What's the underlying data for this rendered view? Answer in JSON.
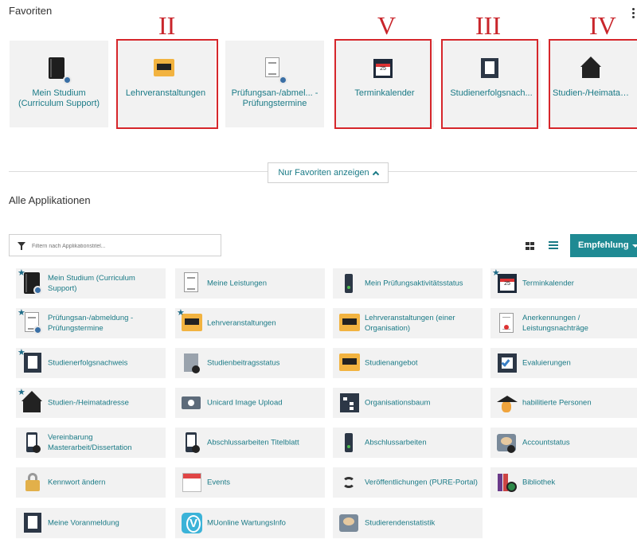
{
  "favorites": {
    "title": "Favoriten",
    "tiles": [
      {
        "label": "Mein Studium (Curriculum Support)",
        "icon": "book-gear-icon"
      },
      {
        "label": "Lehrveranstaltungen",
        "icon": "blackboard-icon"
      },
      {
        "label": "Prüfungsan-/abmel... - Prüfungstermine",
        "icon": "exam-sheet-icon"
      },
      {
        "label": "Terminkalender",
        "icon": "calendar-icon",
        "calendar_day": "25"
      },
      {
        "label": "Studienerfolgsnach...",
        "icon": "document-stack-icon"
      },
      {
        "label": "Studien-/Heimatadr...",
        "icon": "house-icon"
      }
    ],
    "annotations": [
      "II",
      "V",
      "III",
      "IV"
    ],
    "toggle_label": "Nur Favoriten anzeigen"
  },
  "all_apps": {
    "title": "Alle Applikationen",
    "filter_placeholder": "Filtern nach Applikationstitel...",
    "sort_label": "Empfehlung",
    "accent_color": "#1f8a93",
    "annotation_color": "#d6262b",
    "items": [
      {
        "label": "Mein Studium (Curriculum Support)",
        "icon": "book-gear-icon",
        "favorite": true
      },
      {
        "label": "Meine Leistungen",
        "icon": "exam-sheet-icon",
        "favorite": false
      },
      {
        "label": "Mein Prüfungsaktivitätsstatus",
        "icon": "traffic-light-icon",
        "favorite": false
      },
      {
        "label": "Terminkalender",
        "icon": "calendar-icon",
        "favorite": true
      },
      {
        "label": "Prüfungsan-/abmeldung - Prüfungstermine",
        "icon": "exam-sheet-icon",
        "favorite": true
      },
      {
        "label": "Lehrveranstaltungen",
        "icon": "blackboard-icon",
        "favorite": true
      },
      {
        "label": "Lehrveranstaltungen (einer Organisation)",
        "icon": "blackboard-icon",
        "favorite": false
      },
      {
        "label": "Anerkennungen / Leistungsnachträge",
        "icon": "certificate-icon",
        "favorite": false
      },
      {
        "label": "Studienerfolgsnachweis",
        "icon": "document-stack-icon",
        "favorite": true
      },
      {
        "label": "Studienbeitragsstatus",
        "icon": "fee-status-icon",
        "favorite": false
      },
      {
        "label": "Studienangebot",
        "icon": "book-icon",
        "favorite": false
      },
      {
        "label": "Evaluierungen",
        "icon": "checkbox-icon",
        "favorite": false
      },
      {
        "label": "Studien-/Heimatadresse",
        "icon": "house-icon",
        "favorite": true
      },
      {
        "label": "Unicard Image Upload",
        "icon": "camera-icon",
        "favorite": false
      },
      {
        "label": "Organisationsbaum",
        "icon": "org-tree-icon",
        "favorite": false
      },
      {
        "label": "habilitierte Personen",
        "icon": "graduate-icon",
        "favorite": false
      },
      {
        "label": "Vereinbarung Masterarbeit/Dissertation",
        "icon": "agreement-icon",
        "favorite": false
      },
      {
        "label": "Abschlussarbeiten Titelblatt",
        "icon": "title-page-icon",
        "favorite": false
      },
      {
        "label": "Abschlussarbeiten",
        "icon": "thesis-icon",
        "favorite": false
      },
      {
        "label": "Accountstatus",
        "icon": "account-icon",
        "favorite": false
      },
      {
        "label": "Kennwort ändern",
        "icon": "lock-icon",
        "favorite": false
      },
      {
        "label": "Events",
        "icon": "events-icon",
        "favorite": false
      },
      {
        "label": "Veröffentlichungen (PURE-Portal)",
        "icon": "publications-icon",
        "favorite": false
      },
      {
        "label": "Bibliothek",
        "icon": "library-icon",
        "favorite": false
      },
      {
        "label": "Meine Voranmeldung",
        "icon": "preregistration-icon",
        "favorite": false
      },
      {
        "label": "MUonline WartungsInfo",
        "icon": "muonline-icon",
        "favorite": false
      },
      {
        "label": "Studierendenstatistik",
        "icon": "statistics-icon",
        "favorite": false
      }
    ]
  }
}
